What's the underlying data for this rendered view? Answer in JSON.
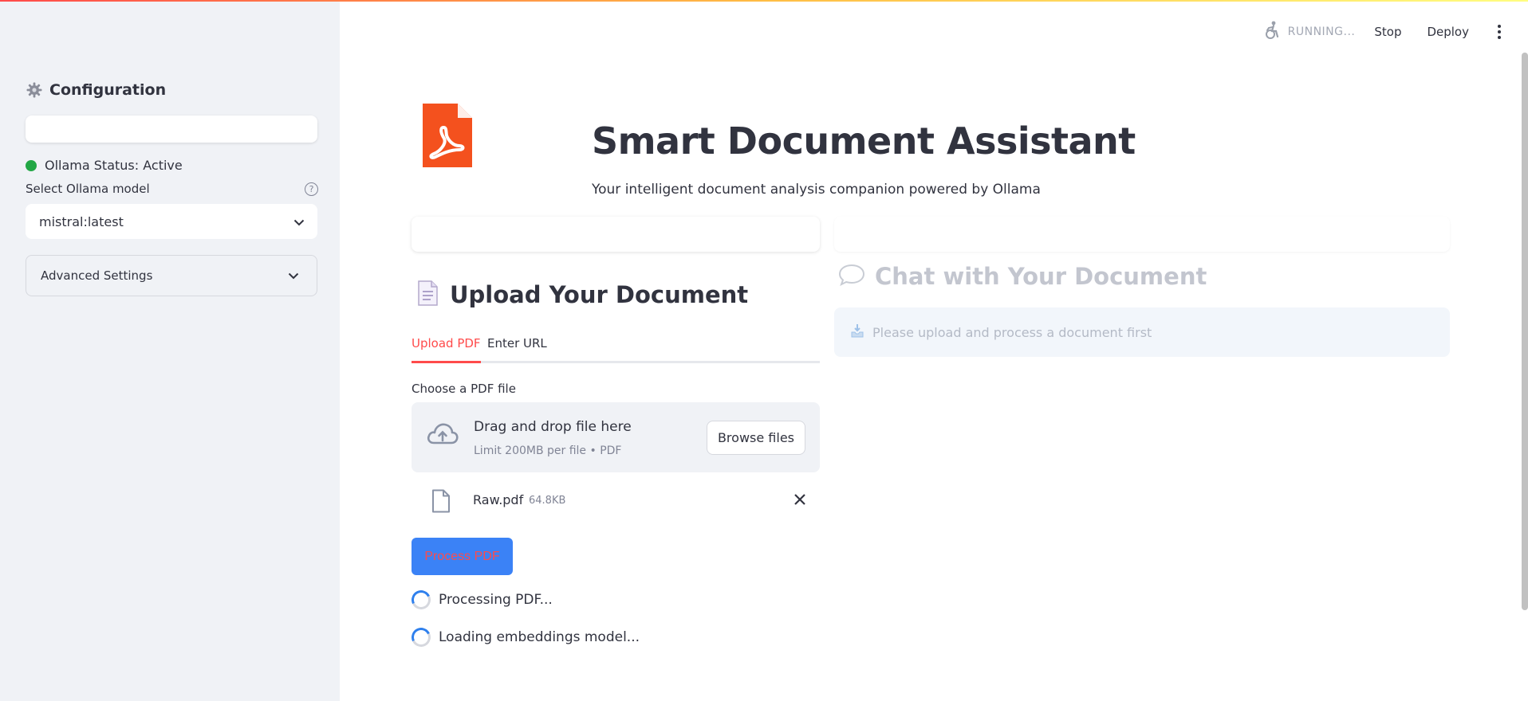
{
  "header": {
    "status_text": "RUNNING...",
    "stop_label": "Stop",
    "deploy_label": "Deploy"
  },
  "sidebar": {
    "title": "Configuration",
    "ollama_status": "Ollama Status: Active",
    "status_color": "#22a745",
    "model_label": "Select Ollama model",
    "model_value": "mistral:latest",
    "advanced_label": "Advanced Settings"
  },
  "main": {
    "title": "Smart Document Assistant",
    "subtitle": "Your intelligent document analysis companion powered by Ollama",
    "upload_title": "Upload Your Document",
    "tabs": [
      {
        "label": "Upload PDF",
        "active": true
      },
      {
        "label": "Enter URL",
        "active": false
      }
    ],
    "choose_label": "Choose a PDF file",
    "dropzone": {
      "main_text": "Drag and drop file here",
      "limit_text": "Limit 200MB per file • PDF",
      "browse_label": "Browse files"
    },
    "file": {
      "name": "Raw.pdf",
      "size": "64.8KB"
    },
    "process_label": "Process PDF",
    "progress": [
      "Processing PDF...",
      "Loading embeddings model..."
    ],
    "chat_title": "Chat with Your Document",
    "chat_info": "Please upload and process a document first"
  },
  "colors": {
    "accent": "#ff4b4b",
    "primary_button": "#3b82f6",
    "sidebar_bg": "#f0f2f6",
    "pdf_logo": "#f4511e"
  },
  "icons": {
    "config": "gear-icon",
    "running": "running-person-icon",
    "upload_doc": "document-icon",
    "dropzone": "cloud-upload-icon",
    "file": "file-icon",
    "remove": "close-icon",
    "chat": "speech-bubble-icon",
    "info": "inbox-tray-icon"
  }
}
